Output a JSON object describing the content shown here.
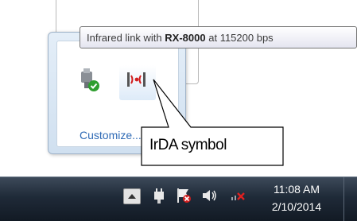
{
  "tooltip": {
    "prefix": "Infrared link with",
    "device": "RX-8000",
    "mid": "at",
    "rate": "115200 bps"
  },
  "tray_popup": {
    "customize_label": "Customize...",
    "icons": [
      "usb-safely-remove-icon",
      "infrared-irda-icon"
    ]
  },
  "callout": {
    "label": "IrDA symbol"
  },
  "taskbar": {
    "time": "11:08 AM",
    "date": "2/10/2014",
    "icons": [
      "show-hidden-icons-button",
      "power-plug-icon",
      "action-center-flag-icon",
      "volume-speaker-icon",
      "network-disconnected-icon"
    ]
  },
  "colors": {
    "link_blue": "#2e6ab5",
    "irda_red": "#d11f1f",
    "check_green": "#2f9e2f",
    "taskbar_dark": "#1f2a38"
  }
}
